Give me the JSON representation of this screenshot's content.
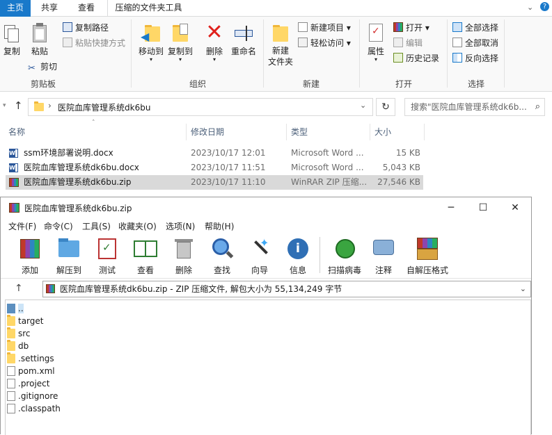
{
  "explorer": {
    "tabs": [
      "主页",
      "共享",
      "查看",
      "压缩的文件夹工具"
    ],
    "clipboard": {
      "label": "剪贴板",
      "copy": "复制",
      "paste": "粘贴",
      "copy_path": "复制路径",
      "paste_shortcut": "粘贴快捷方式",
      "cut": "剪切"
    },
    "organize": {
      "label": "组织",
      "move_to": "移动到",
      "copy_to": "复制到",
      "delete": "删除",
      "rename": "重命名"
    },
    "new": {
      "label": "新建",
      "new_folder": "新建\n文件夹",
      "new_item": "新建项目",
      "easy_access": "轻松访问"
    },
    "open": {
      "label": "打开",
      "properties": "属性",
      "open": "打开",
      "edit": "编辑",
      "history": "历史记录"
    },
    "select": {
      "label": "选择",
      "select_all": "全部选择",
      "select_none": "全部取消",
      "invert": "反向选择"
    },
    "address": "医院血库管理系统dk6bu",
    "search_placeholder": "搜索\"医院血库管理系统dk6b...",
    "columns": [
      "名称",
      "修改日期",
      "类型",
      "大小"
    ],
    "files": [
      {
        "name": "ssm环境部署说明.docx",
        "date": "2023/10/17 12:01",
        "type": "Microsoft Word ...",
        "size": "15 KB",
        "icon": "word-icon"
      },
      {
        "name": "医院血库管理系统dk6bu.docx",
        "date": "2023/10/17 11:51",
        "type": "Microsoft Word ...",
        "size": "5,043 KB",
        "icon": "word-icon"
      },
      {
        "name": "医院血库管理系统dk6bu.zip",
        "date": "2023/10/17 11:10",
        "type": "WinRAR ZIP 压缩...",
        "size": "27,546 KB",
        "icon": "winrar-icon"
      }
    ]
  },
  "winrar": {
    "title": "医院血库管理系统dk6bu.zip",
    "menu": [
      "文件(F)",
      "命令(C)",
      "工具(S)",
      "收藏夹(O)",
      "选项(N)",
      "帮助(H)"
    ],
    "toolbar": [
      "添加",
      "解压到",
      "测试",
      "查看",
      "删除",
      "查找",
      "向导",
      "信息",
      "扫描病毒",
      "注释",
      "自解压格式"
    ],
    "path": "医院血库管理系统dk6bu.zip - ZIP 压缩文件, 解包大小为 55,134,249 字节",
    "entries": [
      {
        "name": "..",
        "kind": "up"
      },
      {
        "name": "target",
        "kind": "folder"
      },
      {
        "name": "src",
        "kind": "folder"
      },
      {
        "name": "db",
        "kind": "folder"
      },
      {
        "name": ".settings",
        "kind": "folder"
      },
      {
        "name": "pom.xml",
        "kind": "xml"
      },
      {
        "name": ".project",
        "kind": "file"
      },
      {
        "name": ".gitignore",
        "kind": "file"
      },
      {
        "name": ".classpath",
        "kind": "file"
      }
    ]
  }
}
